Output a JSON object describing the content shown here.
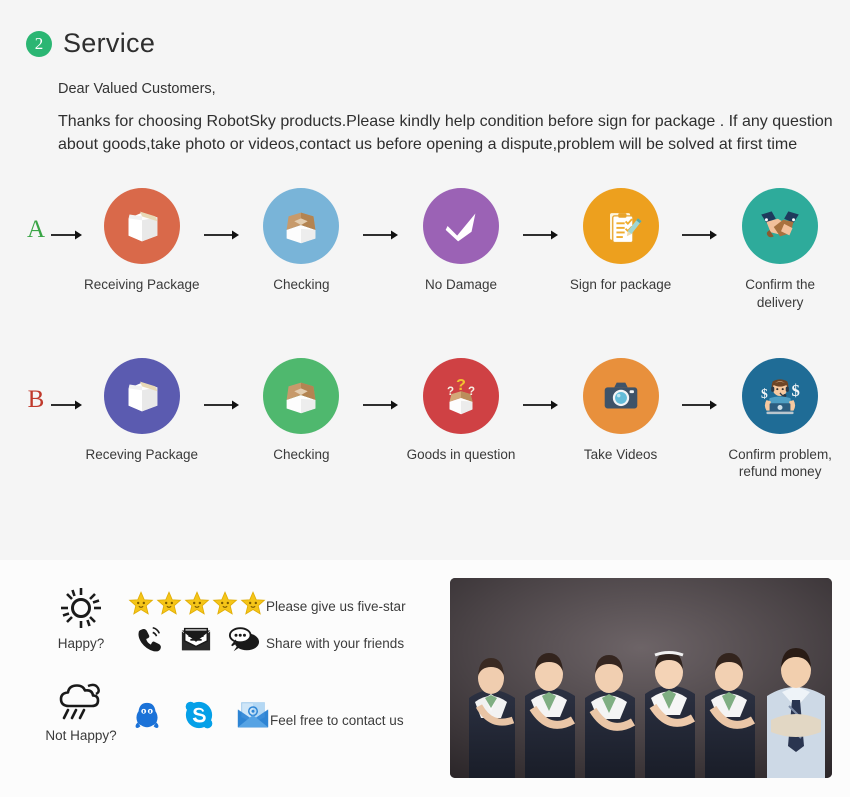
{
  "header": {
    "badge_number": "2",
    "title": "Service",
    "badge_color": "#2bb673"
  },
  "intro": {
    "greeting": "Dear Valued Customers,",
    "body": "Thanks for choosing RobotSky products.Please kindly help condition before sign for package .\nIf any question about goods,take photo or videos,contact us before opening a dispute,problem will be solved at first time"
  },
  "flows": [
    {
      "letter": "A",
      "letter_color": "#3aa546",
      "steps": [
        {
          "label": "Receiving Package",
          "icon": "closed-box-icon",
          "circle_color": "#d9694a"
        },
        {
          "label": "Checking",
          "icon": "open-box-icon",
          "circle_color": "#79b4d8"
        },
        {
          "label": "No Damage",
          "icon": "checkmark-icon",
          "circle_color": "#9b62b5"
        },
        {
          "label": "Sign for package",
          "icon": "clipboard-pencil-icon",
          "circle_color": "#eda01e"
        },
        {
          "label": "Confirm the delivery",
          "icon": "handshake-icon",
          "circle_color": "#2eab9b"
        }
      ]
    },
    {
      "letter": "B",
      "letter_color": "#c0392b",
      "steps": [
        {
          "label": "Receving Package",
          "icon": "closed-box-icon",
          "circle_color": "#5b5bb0"
        },
        {
          "label": "Checking",
          "icon": "open-box-icon",
          "circle_color": "#4fb86e"
        },
        {
          "label": "Goods in question",
          "icon": "question-box-icon",
          "circle_color": "#cf4144"
        },
        {
          "label": "Take Videos",
          "icon": "camera-icon",
          "circle_color": "#e8903c"
        },
        {
          "label": "Confirm problem,\nrefund money",
          "icon": "support-agent-money-icon",
          "circle_color": "#1f6c96"
        }
      ]
    }
  ],
  "contact": {
    "happy": {
      "icon": "sun-icon",
      "label": "Happy?",
      "rating_stars": 5,
      "star_color": "#f5c518",
      "share_icons": [
        "phone-ring-icon",
        "envelope-icon",
        "chat-bubble-icon"
      ],
      "caption_top": "Please give us five-star",
      "caption_bottom": "Share with your friends"
    },
    "not_happy": {
      "icon": "rain-cloud-icon",
      "label": "Not Happy?",
      "contact_icons": [
        "qq-icon",
        "skype-icon",
        "blue-mail-icon"
      ],
      "caption": "Feel free to contact us"
    },
    "photo_alt": "customer-service-team-photo"
  }
}
